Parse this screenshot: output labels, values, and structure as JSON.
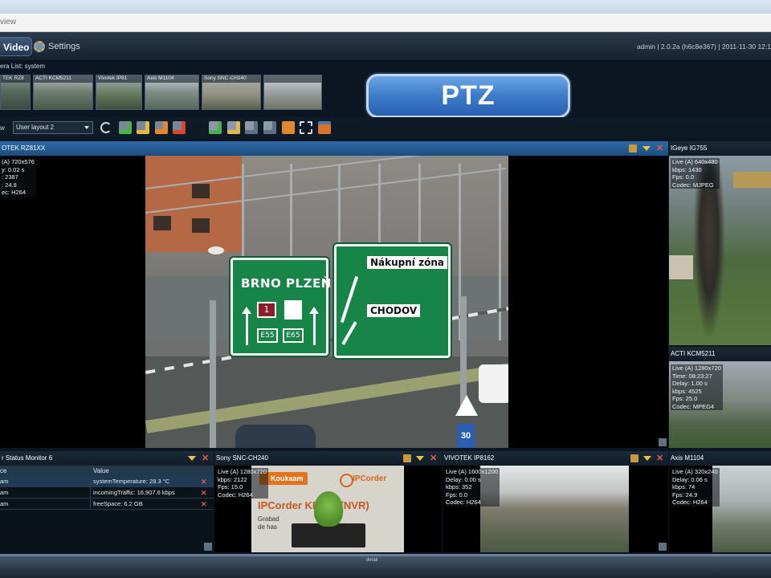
{
  "address_bar": {
    "text": "view"
  },
  "header": {
    "tab_video": "Video",
    "tab_settings": "Settings",
    "user": "admin",
    "version": "2.0.2a (h6c8e367)",
    "datetime": "2011-11-30 12:1"
  },
  "camera_list": {
    "label": "era List: system",
    "thumbnails": [
      {
        "label": "TEK RZ8"
      },
      {
        "label": "ACTI KCM5211"
      },
      {
        "label": "Vivotek IP81"
      },
      {
        "label": "Axis M1104"
      },
      {
        "label": "Sony SNC-CH240"
      },
      {
        "label": ""
      }
    ]
  },
  "ptz_button": {
    "label": "PTZ"
  },
  "toolbar": {
    "label": "w",
    "layout_value": "User layout 2",
    "icons": [
      "refresh-icon",
      "add-camera-icon",
      "rename-camera-icon",
      "copy-camera-icon",
      "delete-camera-icon",
      "add-layout-icon",
      "layout-down-icon",
      "layout-edit-icon",
      "layout-delete-icon",
      "upload-icon",
      "fullscreen-icon",
      "window-icon"
    ]
  },
  "main_camera": {
    "title": "OTEK RZ81XX",
    "overlay": [
      "(A) 720x576",
      "y: 0.02 s",
      ": 2387",
      ": 24.8",
      "ec: H264"
    ],
    "signs": {
      "left_top": "BRNO  PLZEŇ",
      "route_red": "1",
      "e_left": "E55",
      "e_right": "E65",
      "right_top": "Nákupní zóna",
      "right_bottom": "CHODOV",
      "speed": "30"
    }
  },
  "right_cam1": {
    "title": "IGeye IG755",
    "overlay": [
      "Live (A) 640x480",
      "kbps: 1430",
      "Fps: 0.0",
      "Codec: MJPEG"
    ]
  },
  "right_cam2": {
    "title": "ACTI KCM5211",
    "overlay": [
      "Live (A) 1280x720",
      "Time: 08:23:27",
      "Delay: 1.00 s",
      "kbps: 4525",
      "Fps: 25.0",
      "Codec: MPEG4"
    ]
  },
  "status_monitor": {
    "title": "r Status Monitor 6",
    "columns": [
      "ce",
      "Value"
    ],
    "rows": [
      {
        "source": "am",
        "value": "systemTemperature: 28.3 °C"
      },
      {
        "source": "am",
        "value": "incomingTraffic: 16,907.6 kbps"
      },
      {
        "source": "am",
        "value": "freeSpace: 6.2 GB"
      }
    ]
  },
  "bottom_cam1": {
    "title": "Sony SNC-CH240",
    "overlay": [
      "Live (A) 1280x720",
      "kbps: 2122",
      "Fps: 15.0",
      "Codec: H264"
    ],
    "scene": {
      "brand": "Koukaam",
      "logo": "IPCorder",
      "banner": "IPCorder KB200 (NVR)",
      "text1": "Grabad",
      "text2": "de has"
    }
  },
  "bottom_cam2": {
    "title": "VIVOTEK IP8162",
    "overlay": [
      "Live (A) 1600x1200",
      "Delay: 0.00 s",
      "kbps: 352",
      "Fps: 0.0",
      "Codec: H264"
    ]
  },
  "bottom_cam3": {
    "title": "Axis M1104",
    "overlay": [
      "Live (A) 320x240",
      "Delay: 0.06 s",
      "kbps: 74",
      "Fps: 24.9",
      "Codec: H264"
    ]
  },
  "bottom_bar": {
    "label": "detail"
  },
  "colors": {
    "accent": "#2c6aa8",
    "close": "#e25b4a",
    "warn": "#f0c24a"
  }
}
